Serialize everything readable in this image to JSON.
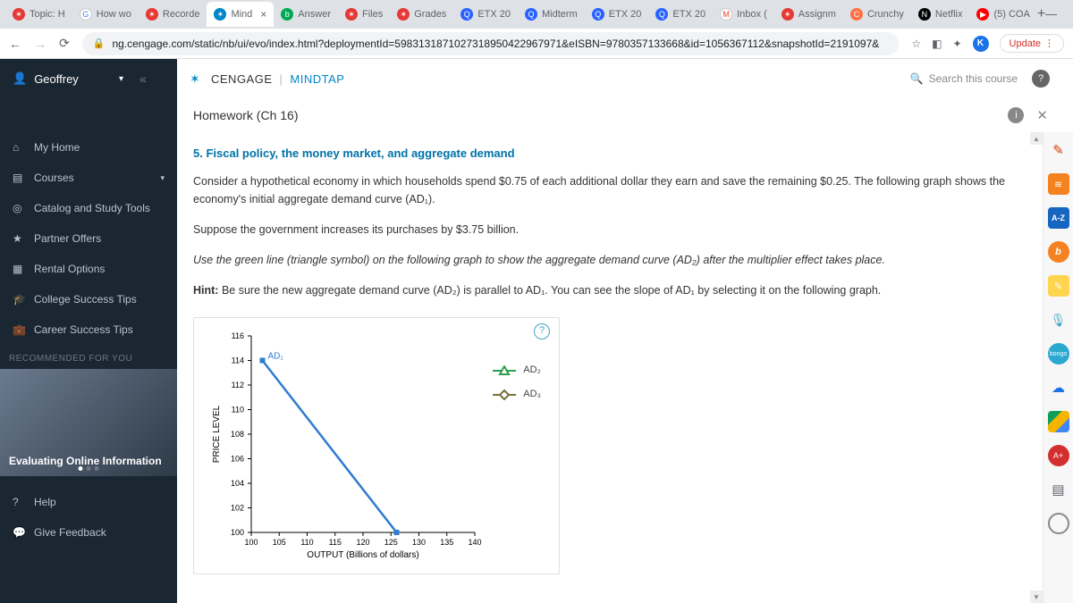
{
  "browser": {
    "tabs": [
      {
        "fav": "✶",
        "favbg": "#e53935",
        "label": "Topic: H"
      },
      {
        "fav": "G",
        "favbg": "#fff",
        "label": "How wo",
        "fc": "#4285f4"
      },
      {
        "fav": "✶",
        "favbg": "#e53935",
        "label": "Recorde"
      },
      {
        "fav": "✶",
        "favbg": "#0085ca",
        "label": "Mind",
        "active": true,
        "close": true
      },
      {
        "fav": "b",
        "favbg": "#0a5",
        "label": "Answer"
      },
      {
        "fav": "✶",
        "favbg": "#e53935",
        "label": "Files"
      },
      {
        "fav": "✶",
        "favbg": "#e53935",
        "label": "Grades"
      },
      {
        "fav": "Q",
        "favbg": "#2962ff",
        "label": "ETX 20"
      },
      {
        "fav": "Q",
        "favbg": "#2962ff",
        "label": "Midterm"
      },
      {
        "fav": "Q",
        "favbg": "#2962ff",
        "label": "ETX 20"
      },
      {
        "fav": "Q",
        "favbg": "#2962ff",
        "label": "ETX 20"
      },
      {
        "fav": "M",
        "favbg": "#fff",
        "label": "Inbox (",
        "fc": "#ea4335"
      },
      {
        "fav": "✶",
        "favbg": "#e53935",
        "label": "Assignm"
      },
      {
        "fav": "C",
        "favbg": "#ff7043",
        "label": "Crunchy"
      },
      {
        "fav": "N",
        "favbg": "#000",
        "label": "Netflix"
      },
      {
        "fav": "▶",
        "favbg": "#f00",
        "label": "(5) COA"
      }
    ],
    "url": "ng.cengage.com/static/nb/ui/evo/index.html?deploymentId=5983131871027318950422967971&eISBN=9780357133668&id=1056367112&snapshotId=2191097&",
    "update": "Update"
  },
  "user": "Geoffrey",
  "brand": {
    "c": "CENGAGE",
    "m": "MINDTAP"
  },
  "search_ph": "Search this course",
  "assignment": "Homework (Ch 16)",
  "sidebar": {
    "items": [
      {
        "ic": "⌂",
        "label": "My Home"
      },
      {
        "ic": "▤",
        "label": "Courses",
        "expand": true
      },
      {
        "ic": "◎",
        "label": "Catalog and Study Tools"
      },
      {
        "ic": "★",
        "label": "Partner Offers"
      },
      {
        "ic": "▦",
        "label": "Rental Options"
      },
      {
        "ic": "🎓",
        "label": "College Success Tips"
      },
      {
        "ic": "💼",
        "label": "Career Success Tips"
      }
    ],
    "rec_hdr": "RECOMMENDED FOR YOU",
    "rec_title": "Evaluating Online Information",
    "foot": [
      {
        "ic": "?",
        "label": "Help"
      },
      {
        "ic": "💬",
        "label": "Give Feedback"
      }
    ]
  },
  "q": {
    "title": "5. Fiscal policy, the money market, and aggregate demand",
    "p1": "Consider a hypothetical economy in which households spend $0.75 of each additional dollar they earn and save the remaining $0.25. The following graph shows the economy's initial aggregate demand curve (AD₁).",
    "p2": "Suppose the government increases its purchases by $3.75 billion.",
    "p3": "Use the green line (triangle symbol) on the following graph to show the aggregate demand curve (AD₂) after the multiplier effect takes place.",
    "hint_l": "Hint:",
    "hint": " Be sure the new aggregate demand curve (AD₂) is parallel to AD₁. You can see the slope of AD₁ by selecting it on the following graph."
  },
  "chart_data": {
    "type": "line",
    "xlabel": "OUTPUT (Billions of dollars)",
    "ylabel": "PRICE LEVEL",
    "xlim": [
      100,
      140
    ],
    "ylim": [
      100,
      116
    ],
    "xticks": [
      100,
      105,
      110,
      115,
      120,
      125,
      130,
      135,
      140
    ],
    "yticks": [
      100,
      102,
      104,
      106,
      108,
      110,
      112,
      114,
      116
    ],
    "series": [
      {
        "name": "AD₁",
        "color": "#2f7bd1",
        "points": [
          [
            102,
            114
          ],
          [
            126,
            100
          ]
        ]
      }
    ],
    "legend": [
      {
        "name": "AD₂",
        "sym": "triangle",
        "color": "#2e9e4a"
      },
      {
        "name": "AD₃",
        "sym": "diamond",
        "color": "#7b6f3a"
      }
    ]
  },
  "rt": [
    "edit",
    "rss",
    "A-Z",
    "b",
    "y",
    "mic",
    "bongo",
    "cloud",
    "drive",
    "A+",
    "book",
    "circ"
  ]
}
